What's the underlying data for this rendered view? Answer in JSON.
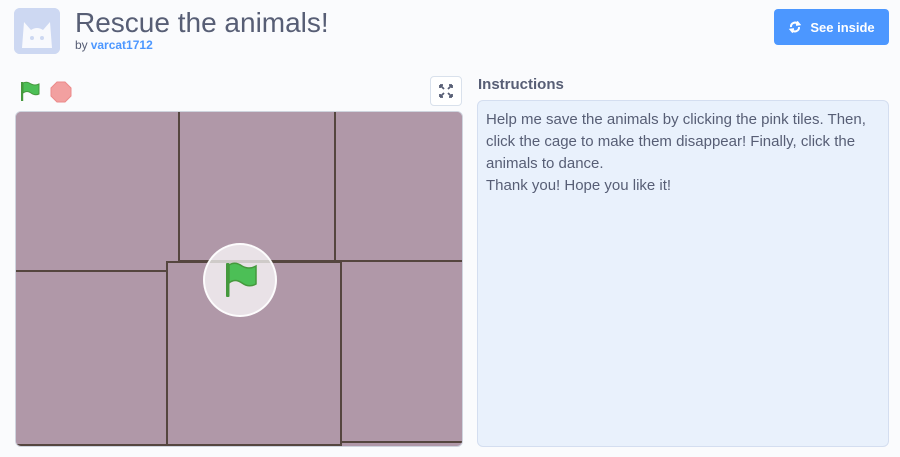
{
  "project": {
    "title": "Rescue the animals!",
    "by_prefix": "by",
    "author": "varcat1712",
    "thumbnail_icon": "cat-thumbnail-icon"
  },
  "toolbar": {
    "see_inside_label": "See inside",
    "see_inside_icon": "remix-arrows-icon",
    "green_flag_icon": "green-flag-icon",
    "stop_icon": "stop-sign-icon",
    "fullscreen_icon": "fullscreen-icon"
  },
  "stage": {
    "background_color": "#b098a8",
    "tile_color": "#b098a8",
    "tile_border_color": "#55463f",
    "overlay_icon": "green-flag-icon"
  },
  "instructions": {
    "heading": "Instructions",
    "paragraphs": [
      "Help me save the animals by clicking the pink tiles. Then, click the cage to make them disappear! Finally, click the animals to dance.",
      "Thank you! Hope you like it!"
    ]
  },
  "colors": {
    "accent": "#4c97ff",
    "text": "#575e75",
    "flag_green": "#4cbf56",
    "stop_red": "#ec5959"
  }
}
